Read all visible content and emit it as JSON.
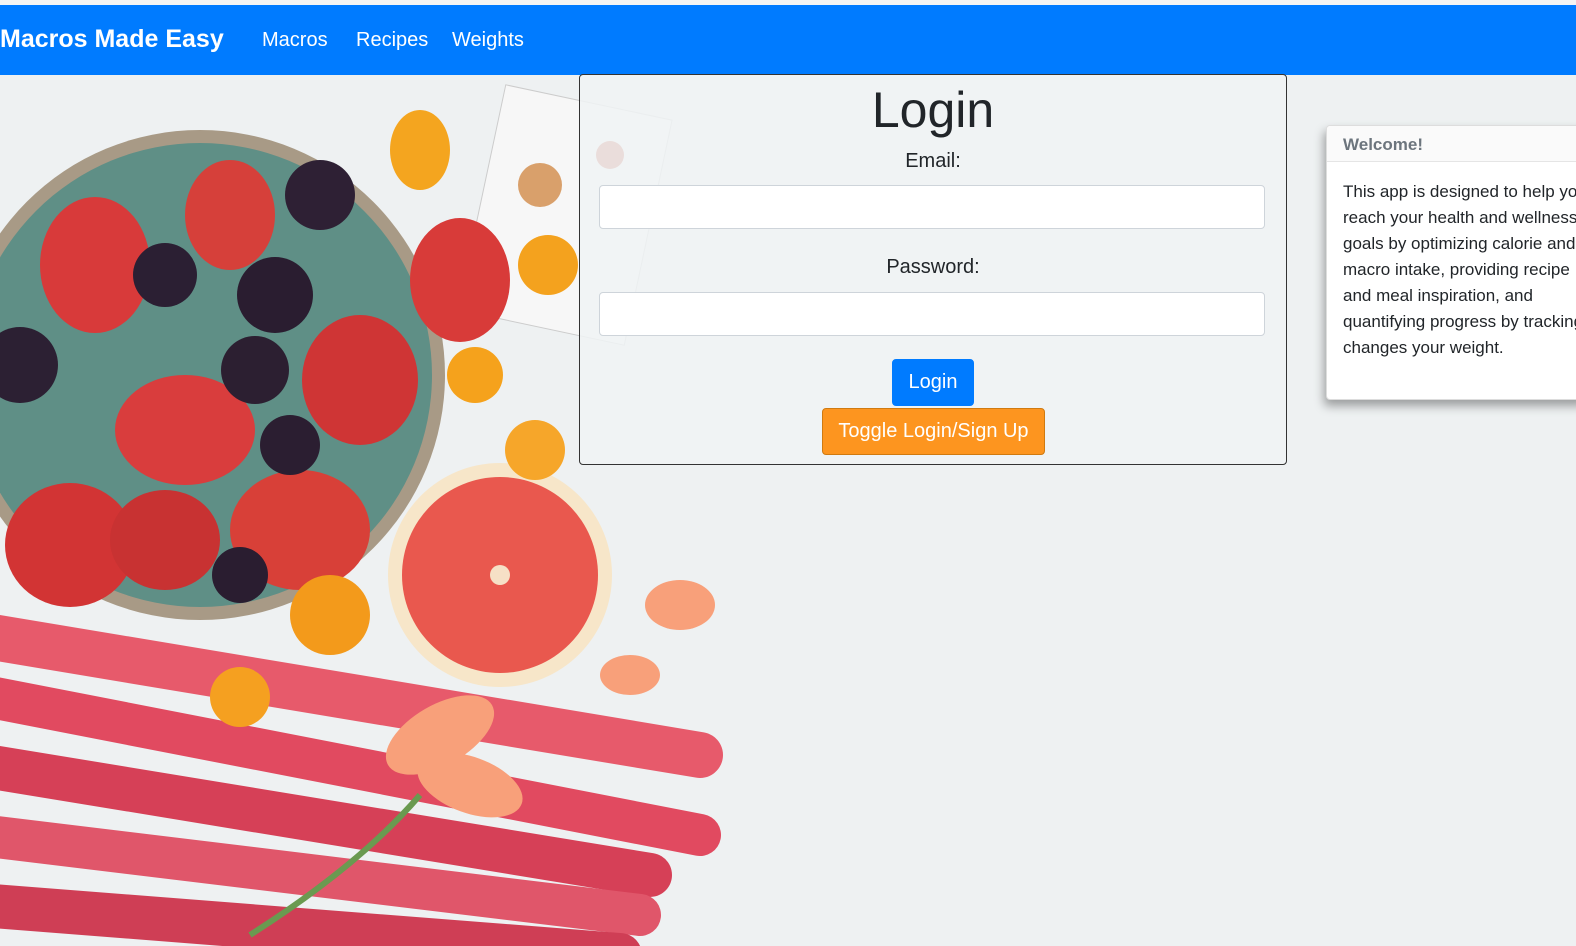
{
  "navbar": {
    "brand": "Macros Made Easy",
    "links": [
      "Macros",
      "Recipes",
      "Weights"
    ],
    "color": "#007bff"
  },
  "login": {
    "title": "Login",
    "email_label": "Email:",
    "email_value": "",
    "password_label": "Password:",
    "password_value": "",
    "login_button": "Login",
    "toggle_button": "Toggle Login/Sign Up",
    "toggle_color": "#fd951f"
  },
  "welcome": {
    "title": "Welcome!",
    "body": "This app is designed to help you reach your health and wellness goals by optimizing calorie and macro intake, providing recipe and meal inspiration, and quantifying progress by tracking changes your weight."
  }
}
